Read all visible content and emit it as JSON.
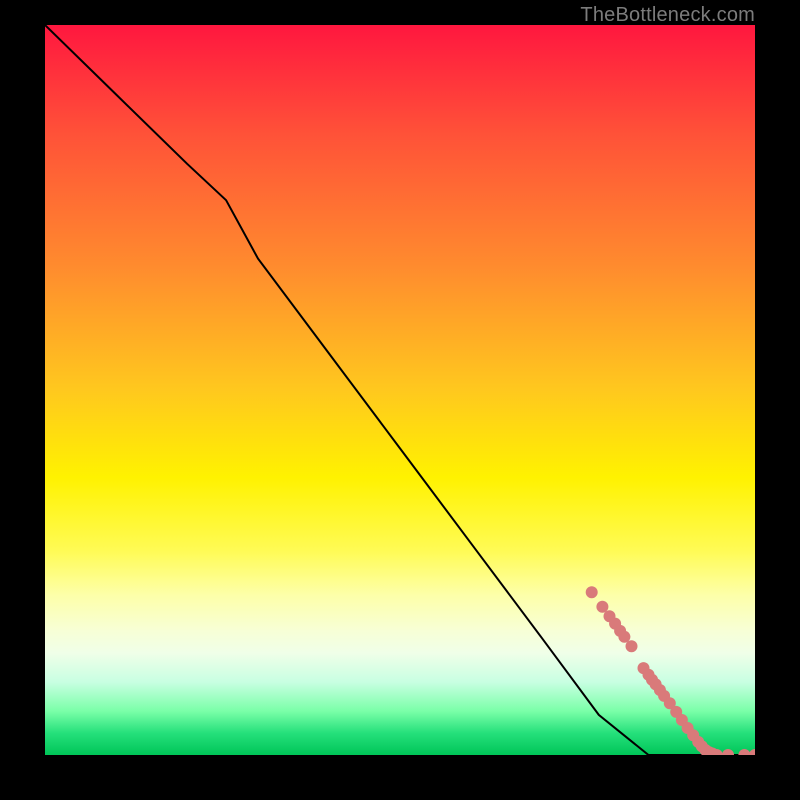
{
  "attribution": "TheBottleneck.com",
  "colors": {
    "background": "#000000",
    "curve": "#000000",
    "dots": "#d97a7a",
    "gradient_top": "#ff173f",
    "gradient_mid": "#fff200",
    "gradient_bottom": "#00c558"
  },
  "chart_data": {
    "type": "line",
    "title": "",
    "xlabel": "",
    "ylabel": "",
    "xlim": [
      0,
      100
    ],
    "ylim": [
      0,
      100
    ],
    "grid": false,
    "series": [
      {
        "name": "bottleneck-curve",
        "x": [
          0,
          10,
          20,
          25.5,
          30,
          40,
          50,
          60,
          70,
          78,
          85,
          90,
          92,
          94,
          96,
          100
        ],
        "y": [
          100,
          90.5,
          81,
          76,
          68,
          55,
          42,
          29,
          16,
          5.5,
          0,
          0,
          0,
          0,
          0,
          0
        ]
      }
    ],
    "points": [
      {
        "name": "p1",
        "x": 77.0,
        "y": 22.3
      },
      {
        "name": "p2",
        "x": 78.5,
        "y": 20.3
      },
      {
        "name": "p3",
        "x": 79.5,
        "y": 19.0
      },
      {
        "name": "p4",
        "x": 80.3,
        "y": 18.0
      },
      {
        "name": "p5",
        "x": 81.0,
        "y": 17.0
      },
      {
        "name": "p6",
        "x": 81.6,
        "y": 16.2
      },
      {
        "name": "p7",
        "x": 82.6,
        "y": 14.9
      },
      {
        "name": "p8",
        "x": 84.3,
        "y": 11.9
      },
      {
        "name": "p9",
        "x": 85.0,
        "y": 11.0
      },
      {
        "name": "p10",
        "x": 85.5,
        "y": 10.3
      },
      {
        "name": "p11",
        "x": 86.0,
        "y": 9.7
      },
      {
        "name": "p12",
        "x": 86.6,
        "y": 8.9
      },
      {
        "name": "p13",
        "x": 87.2,
        "y": 8.1
      },
      {
        "name": "p14",
        "x": 88.0,
        "y": 7.1
      },
      {
        "name": "p15",
        "x": 88.9,
        "y": 5.9
      },
      {
        "name": "p16",
        "x": 89.7,
        "y": 4.8
      },
      {
        "name": "p17",
        "x": 90.5,
        "y": 3.7
      },
      {
        "name": "p18",
        "x": 91.3,
        "y": 2.7
      },
      {
        "name": "p19",
        "x": 92.0,
        "y": 1.8
      },
      {
        "name": "p20",
        "x": 92.5,
        "y": 1.2
      },
      {
        "name": "p21",
        "x": 93.0,
        "y": 0.7
      },
      {
        "name": "p22",
        "x": 93.5,
        "y": 0.4
      },
      {
        "name": "p23",
        "x": 94.0,
        "y": 0.2
      },
      {
        "name": "p24",
        "x": 94.6,
        "y": 0.0
      },
      {
        "name": "p25",
        "x": 96.2,
        "y": 0.0
      },
      {
        "name": "p26",
        "x": 98.5,
        "y": 0.0
      },
      {
        "name": "p27",
        "x": 100.0,
        "y": 0.0
      }
    ]
  }
}
